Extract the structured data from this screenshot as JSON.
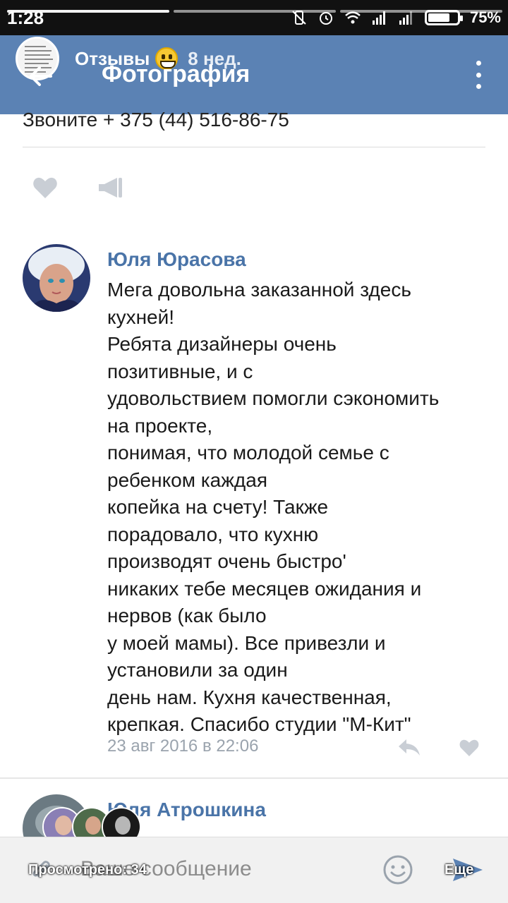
{
  "status_bar": {
    "time": "1:28",
    "battery": "75%",
    "battery_level": 0.75,
    "icons": [
      "mute-vibrate-icon",
      "alarm-icon",
      "wifi-icon",
      "signal-icon",
      "signal-icon",
      "battery-icon"
    ]
  },
  "story": {
    "title": "Отзывы",
    "emoji": "grinning-emoji",
    "age": "8 нед."
  },
  "header": {
    "title": "Фотография",
    "color": "#5b82b4"
  },
  "post": {
    "phone_text": "Звоните + 375 (44) 516-86-75"
  },
  "comments": [
    {
      "author": "Юля Юрасова",
      "lines": [
        "Мега довольна заказанной здесь",
        "кухней!",
        "Ребята дизайнеры очень",
        "позитивные, и с",
        "удовольствием помогли сэкономить",
        "на проекте,",
        "понимая, что молодой семье с",
        "ребенком каждая",
        "копейка на счету! Также",
        "порадовало, что кухню",
        "производят очень быстро'",
        "никаких тебе месяцев ожидания и",
        "нервов (как было",
        "у моей мамы). Все привезли и",
        "установили за один",
        "день нам. Кухня качественная,",
        "крепкая. Спасибо студии \"М-Кит\""
      ],
      "date": "23 авг 2016 в 22:06"
    },
    {
      "author": "Юля Атрошкина"
    }
  ],
  "composer": {
    "placeholder": "Ваше сообщение"
  },
  "story_footer": {
    "views": "Просмотрено: 34",
    "more": "Еще"
  },
  "colors": {
    "link": "#4a74a8",
    "meta": "#9aa3ad",
    "icon_gray": "#c9ced5"
  }
}
